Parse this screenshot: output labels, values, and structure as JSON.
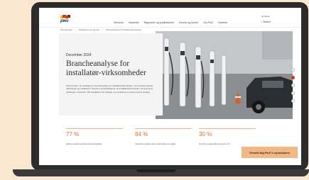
{
  "header": {
    "logo_text": "pwc",
    "logo_colors": [
      "#fdb913",
      "#e0301e",
      "#d04a02",
      "#a32020"
    ],
    "nav_items": [
      "Services",
      "Industrier",
      "Rapporter og publikationer",
      "Events og kurser",
      "Om PwC",
      "Karriere"
    ],
    "language": "Dansk",
    "search_label": "Search"
  },
  "breadcrumb": [
    "PwC Danmark",
    "Publikationer og rapporter",
    "Brancheanalyse for installatørvirksomheder"
  ],
  "hero": {
    "date": "December 2024",
    "title": "Brancheanalyse for installatør-virksomheder",
    "lede": "PwC har igen i år udarbejdet en brancheanalyse for installatørvirksomheder. Vores analyse belyser udfordringer og muligheder i branchen og beskæftigelse, af installatørvirksomheder i forventning til udviklingen i branchen. 250 installatører har deltaget, og resultaterne er samlet i denne analyse."
  },
  "stats": [
    {
      "value": "77 %",
      "description": "oplever et stigende fokus på bæredygtighed"
    },
    {
      "value": "84 %",
      "description": "i branchen vurderer deres virksomhed som digital"
    },
    {
      "value": "30 %",
      "description": "har hørt et spørgsmål de seneste 2 år"
    }
  ],
  "cta_label": "Tilmeld dig PwC's nyhedsbrev",
  "accent_color": "#e86d2e"
}
